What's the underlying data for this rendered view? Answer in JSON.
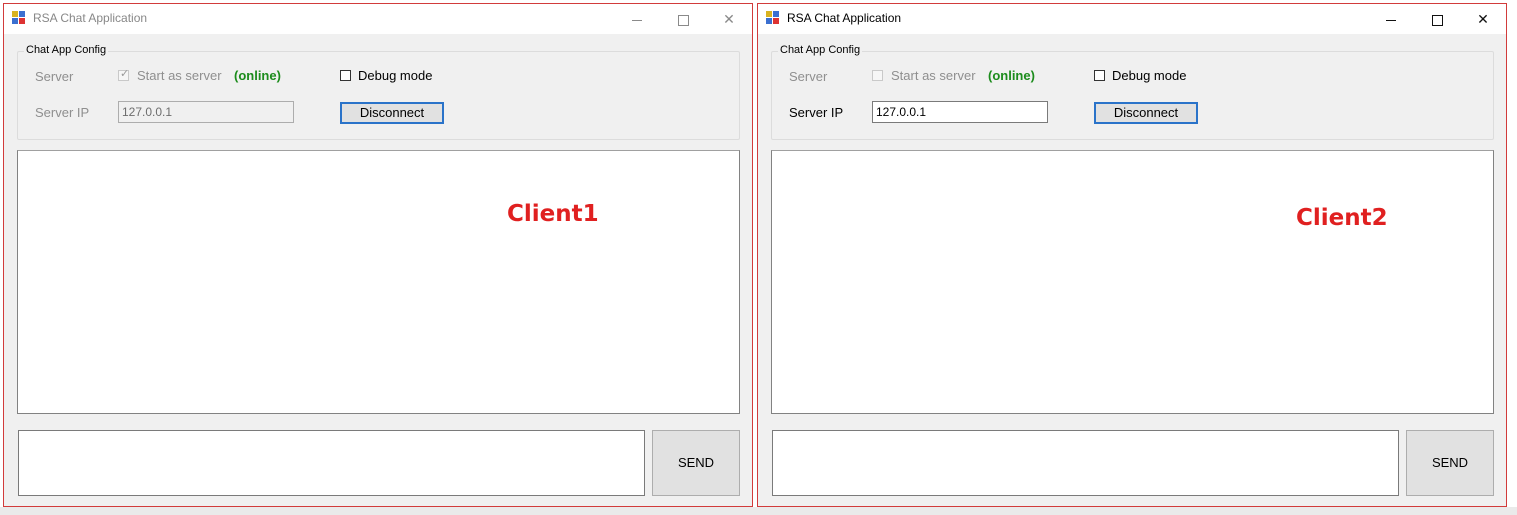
{
  "windows": [
    {
      "title": "RSA Chat Application",
      "titlebar": {
        "minimize": "—",
        "close": "✕"
      },
      "config": {
        "legend": "Chat App Config",
        "server_label": "Server",
        "start_as_server_label": "Start as server",
        "start_as_server_checked": true,
        "status": "(online)",
        "debug_mode_label": "Debug mode",
        "debug_mode_checked": false,
        "server_ip_label": "Server IP",
        "server_ip_value": "127.0.0.1",
        "connect_button": "Disconnect"
      },
      "chat_overlay_label": "Client1",
      "message_input_value": "",
      "send_button": "SEND"
    },
    {
      "title": "RSA Chat Application",
      "titlebar": {
        "minimize": "—",
        "close": "✕"
      },
      "config": {
        "legend": "Chat App Config",
        "server_label": "Server",
        "start_as_server_label": "Start as server",
        "start_as_server_checked": false,
        "status": "(online)",
        "debug_mode_label": "Debug mode",
        "debug_mode_checked": false,
        "server_ip_label": "Server IP",
        "server_ip_value": "127.0.0.1",
        "connect_button": "Disconnect"
      },
      "chat_overlay_label": "Client2",
      "message_input_value": "",
      "send_button": "SEND"
    }
  ],
  "colors": {
    "status_online": "#1c8c1c",
    "annotation": "#e02020",
    "focus_border": "#2a73c9"
  }
}
